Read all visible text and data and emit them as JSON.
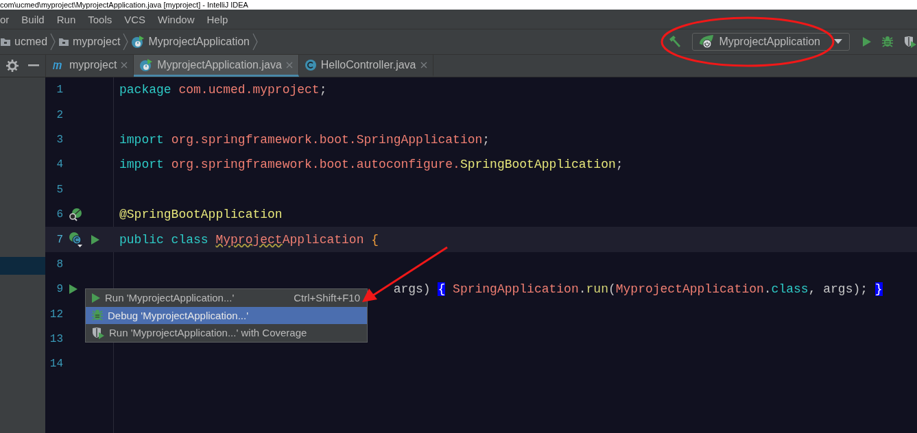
{
  "window": {
    "title": "com\\ucmed\\myproject\\MyprojectApplication.java [myproject] - IntelliJ IDEA"
  },
  "menu": [
    "or",
    "Build",
    "Run",
    "Tools",
    "VCS",
    "Window",
    "Help"
  ],
  "breadcrumbs": [
    {
      "label": "ucmed",
      "kind": "folder"
    },
    {
      "label": "myproject",
      "kind": "folder"
    },
    {
      "label": "MyprojectApplication",
      "kind": "spring"
    }
  ],
  "toolbar": {
    "run_config": "MyprojectApplication",
    "actions": [
      {
        "kind": "run"
      },
      {
        "kind": "debug"
      },
      {
        "kind": "coverage"
      }
    ]
  },
  "tabs": [
    {
      "label": "myproject",
      "kind": "module",
      "selected": false
    },
    {
      "label": "MyprojectApplication.java",
      "kind": "spring",
      "selected": true
    },
    {
      "label": "HelloController.java",
      "kind": "class",
      "selected": false
    }
  ],
  "code_lines": [
    {
      "number": "1",
      "current": false,
      "tokens": [
        {
          "text": "package ",
          "kind": "keyword"
        },
        {
          "text": "com.ucmed.myproject",
          "kind": "ident"
        },
        {
          "text": ";",
          "kind": "plain"
        }
      ]
    },
    {
      "number": "2",
      "current": false
    },
    {
      "number": "3",
      "current": false,
      "tokens": [
        {
          "text": "import ",
          "kind": "keyword"
        },
        {
          "text": "org.springframework.boot.SpringApplication",
          "kind": "ident"
        },
        {
          "text": ";",
          "kind": "plain"
        }
      ]
    },
    {
      "number": "4",
      "current": false,
      "tokens": [
        {
          "text": "import ",
          "kind": "keyword"
        },
        {
          "text": "org.springframework.boot.autoconfigure.",
          "kind": "ident"
        },
        {
          "text": "SpringBootApplication",
          "kind": "annotation"
        },
        {
          "text": ";",
          "kind": "plain"
        }
      ]
    },
    {
      "number": "5",
      "current": false
    },
    {
      "number": "6",
      "current": false,
      "gutter_icons": [
        {
          "kind": "bean"
        }
      ],
      "tokens": [
        {
          "text": "@SpringBootApplication",
          "kind": "annotation"
        }
      ]
    },
    {
      "number": "7",
      "current": true,
      "gutter_icons": [
        {
          "kind": "class"
        },
        {
          "kind": "run"
        }
      ],
      "tokens": [
        {
          "text": "public class ",
          "kind": "keyword"
        },
        {
          "text": "Myproject",
          "kind": "warn"
        },
        {
          "text": "Application",
          "kind": "ident"
        },
        {
          "text": " {",
          "kind": "brace"
        }
      ]
    },
    {
      "number": "8",
      "current": false
    },
    {
      "number": "9",
      "current": false,
      "covered": true,
      "gutter_icons": [
        {
          "kind": "run"
        }
      ],
      "tokens": [
        {
          "text": "args) ",
          "kind": "plain"
        },
        {
          "text": "{",
          "kind": "match"
        },
        {
          "text": " SpringApplication",
          "kind": "ident"
        },
        {
          "text": ".",
          "kind": "plain"
        },
        {
          "text": "run",
          "kind": "method"
        },
        {
          "text": "(",
          "kind": "plain"
        },
        {
          "text": "MyprojectApplication",
          "kind": "ident"
        },
        {
          "text": ".",
          "kind": "plain"
        },
        {
          "text": "class",
          "kind": "keyword"
        },
        {
          "text": ", args); ",
          "kind": "plain"
        },
        {
          "text": "}",
          "kind": "match"
        }
      ]
    },
    {
      "number": "12",
      "current": false
    },
    {
      "number": "13",
      "current": false
    },
    {
      "number": "14",
      "current": false
    }
  ],
  "popup": [
    {
      "label": "Run 'MyprojectApplication...'",
      "shortcut": "Ctrl+Shift+F10",
      "kind": "run",
      "selected": false
    },
    {
      "label": "Debug 'MyprojectApplication...'",
      "kind": "debug",
      "selected": true
    },
    {
      "label": "Run 'MyprojectApplication...' with Coverage",
      "kind": "coverage",
      "selected": false
    }
  ],
  "annotations": [
    {
      "kind": "ellipse"
    },
    {
      "kind": "arrow"
    }
  ]
}
